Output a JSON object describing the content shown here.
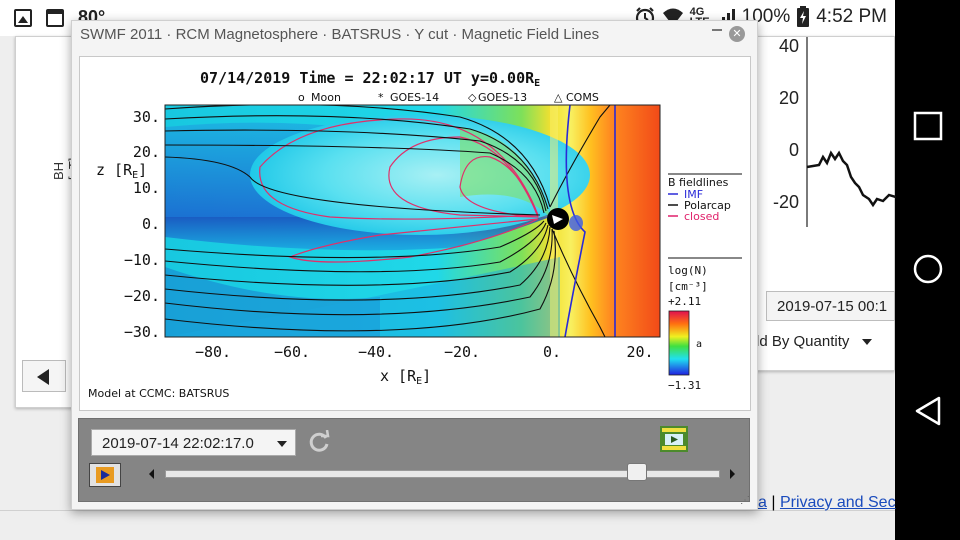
{
  "status_bar": {
    "temperature": "80°",
    "network": "4G",
    "network_sub": "LTE",
    "battery": "100%",
    "time": "4:52 PM"
  },
  "background_page": {
    "left_axis_label": "BH [nT]",
    "right_ticks": [
      "40",
      "20",
      "0",
      "-20"
    ],
    "date_dropdown": "2019-07-15 00:1",
    "quantity_dropdown": "ld By Quantity",
    "footer_link_fragment": "va",
    "footer_separator": "|",
    "footer_link_privacy": "Privacy and Sec"
  },
  "widget": {
    "title": "SWMF 2011 · RCM Magnetosphere · BATSRUS · Y cut · Magnetic Field Lines",
    "plot": {
      "header_prefix": "07/14/2019 Time = 22:02:17 UT y=",
      "header_y_value": "0.00R",
      "header_y_sub": "E",
      "legend_markers": [
        {
          "symbol": "o",
          "label": "Moon"
        },
        {
          "symbol": "*",
          "label": "GOES-14"
        },
        {
          "symbol": "◇",
          "label": "GOES-13"
        },
        {
          "symbol": "△",
          "label": "COMS"
        }
      ],
      "y_label": "z [R",
      "y_label_sub": "E",
      "x_label": "x [R",
      "x_label_sub": "E",
      "y_ticks": [
        "30.",
        "20.",
        "10.",
        "0.",
        "−10.",
        "−20.",
        "−30."
      ],
      "x_ticks": [
        "−80.",
        "−60.",
        "−40.",
        "−20.",
        "0.",
        "20."
      ],
      "fieldline_legend": {
        "title": "B fieldlines",
        "entries": [
          {
            "label": "IMF",
            "color": "#2a2ad8"
          },
          {
            "label": "Polarcap",
            "color": "#111111"
          },
          {
            "label": "closed",
            "color": "#e0206a"
          }
        ]
      },
      "colorbar": {
        "title": "log(N)",
        "unit": "[cm⁻³]",
        "max_label": "+2.11",
        "min_label": "−1.31",
        "tick_label": "a"
      },
      "footer": "Model at CCMC: BATSRUS"
    },
    "time_select_value": "2019-07-14 22:02:17.0",
    "slider_position": 0.85
  }
}
